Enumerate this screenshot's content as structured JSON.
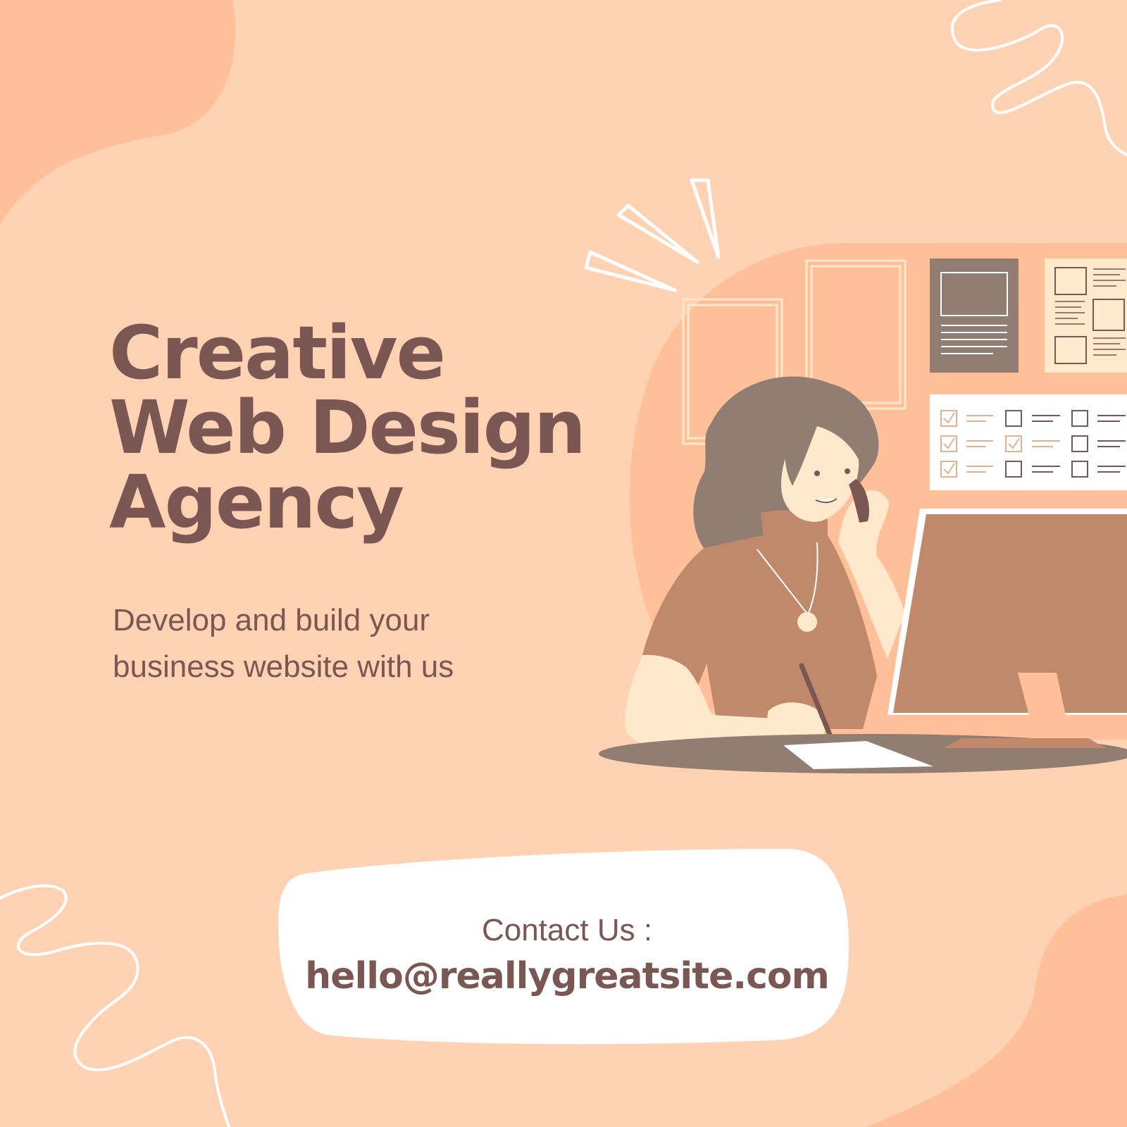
{
  "headline": {
    "line1": "Creative",
    "line2": "Web Design",
    "line3": "Agency"
  },
  "subtitle": {
    "line1": "Develop and build your",
    "line2": "business website with us"
  },
  "contact": {
    "label": "Contact Us :",
    "email": "hello@reallygreatsite.com"
  },
  "colors": {
    "background": "#ffd2b4",
    "blob": "#ffbf98",
    "text": "#7a5752",
    "accent_brown": "#c0896b",
    "gray_brown": "#917d71",
    "cream": "#ffe9cc",
    "white": "#ffffff"
  }
}
